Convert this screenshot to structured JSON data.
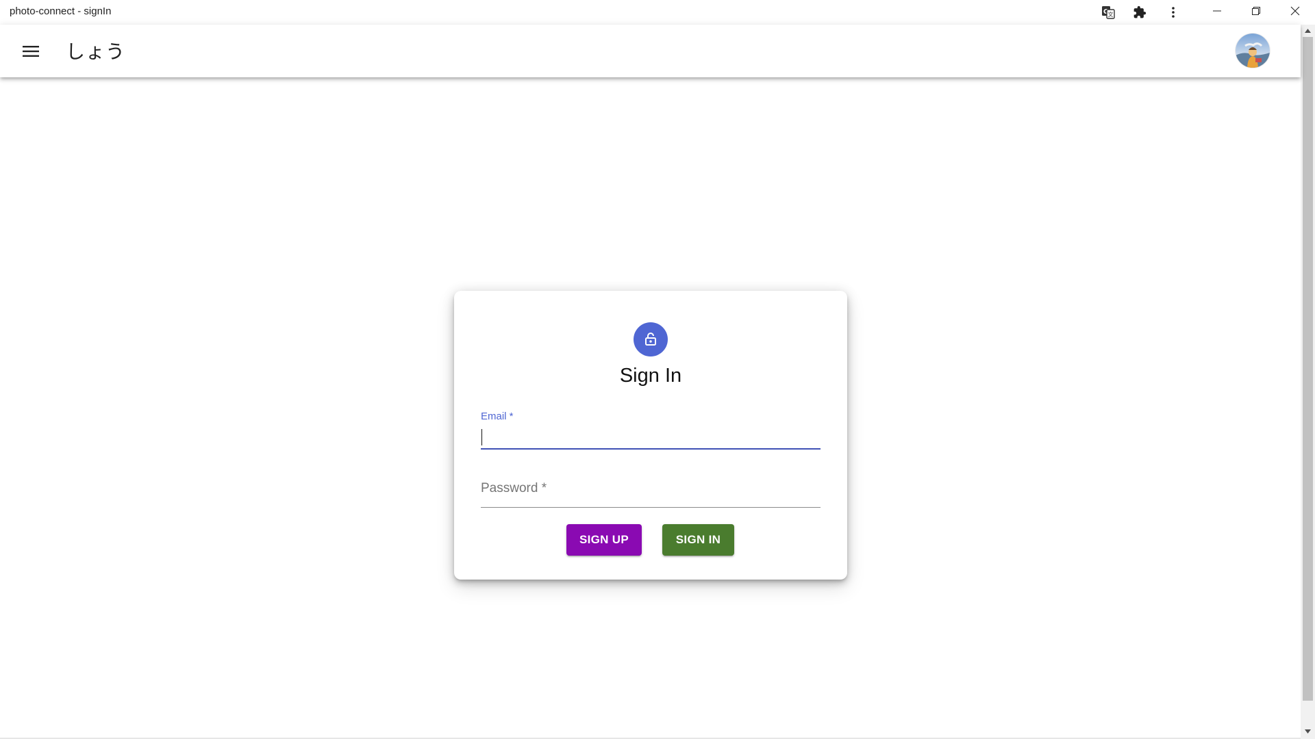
{
  "window": {
    "title": "photo-connect - signIn",
    "icons": [
      "translate-icon",
      "extensions-icon",
      "more-vert-icon"
    ],
    "controls": [
      "minimize-icon",
      "restore-icon",
      "close-icon"
    ]
  },
  "appbar": {
    "title": "しょう",
    "menu_icon": "hamburger-menu-icon",
    "avatar": "user-avatar"
  },
  "signin": {
    "icon": "lock-open-icon",
    "heading": "Sign In",
    "email": {
      "label": "Email *",
      "value": ""
    },
    "password": {
      "label": "Password *",
      "value": ""
    },
    "signup_button": "SIGN UP",
    "signin_button": "SIGN IN"
  },
  "colors": {
    "primary": "#4f66d3",
    "signup_button": "#8a0ab2",
    "signin_button": "#4a7c2e",
    "focus_underline": "#3f51b5"
  }
}
